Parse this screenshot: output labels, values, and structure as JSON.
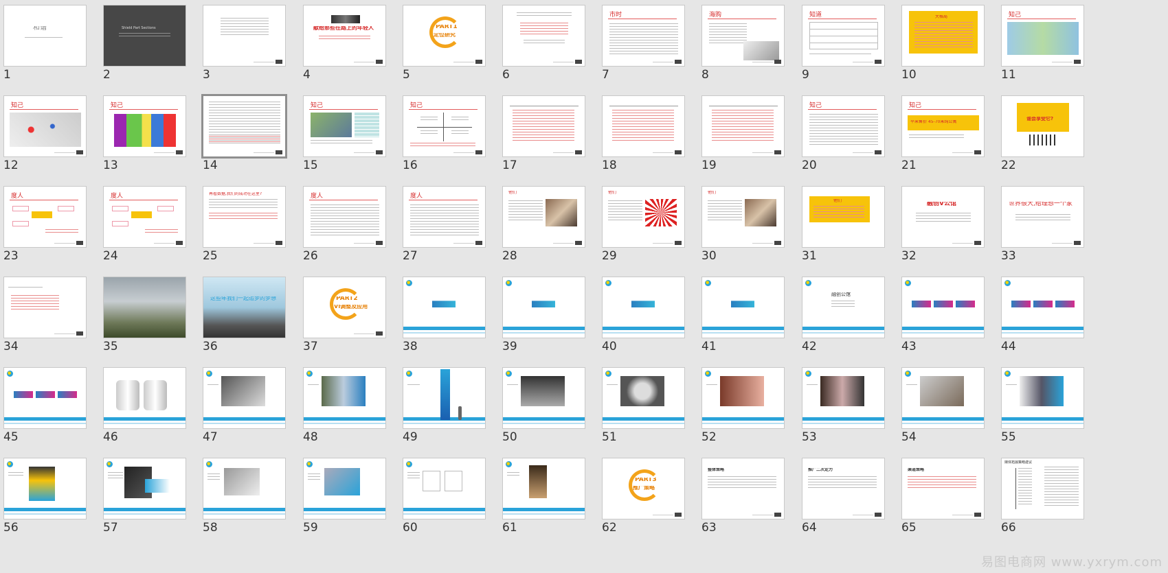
{
  "window": {
    "title": ""
  },
  "slides": [
    {
      "n": "1",
      "kind": "title-white",
      "text": "和谐"
    },
    {
      "n": "2",
      "kind": "title-dark",
      "text": "Shield Part Sections"
    },
    {
      "n": "3",
      "kind": "text-center"
    },
    {
      "n": "4",
      "kind": "banner",
      "text": "献给那些在路上的年轻人"
    },
    {
      "n": "5",
      "kind": "part",
      "text": "PART1",
      "sub": "定位研究"
    },
    {
      "n": "6",
      "kind": "text-center-red"
    },
    {
      "n": "7",
      "kind": "title-text",
      "title": "市时"
    },
    {
      "n": "8",
      "kind": "title-photo",
      "title": "海购"
    },
    {
      "n": "9",
      "kind": "table",
      "title": "知道"
    },
    {
      "n": "10",
      "kind": "yellow-block",
      "text": "大格局"
    },
    {
      "n": "11",
      "kind": "map",
      "title": "知己"
    },
    {
      "n": "12",
      "kind": "map2",
      "title": "知己"
    },
    {
      "n": "13",
      "kind": "colormap",
      "title": "知己"
    },
    {
      "n": "14",
      "kind": "text",
      "selected": true
    },
    {
      "n": "15",
      "kind": "photo-table",
      "title": "知己"
    },
    {
      "n": "16",
      "kind": "cross",
      "title": "知己"
    },
    {
      "n": "17",
      "kind": "timeline"
    },
    {
      "n": "18",
      "kind": "timeline"
    },
    {
      "n": "19",
      "kind": "timeline"
    },
    {
      "n": "20",
      "kind": "title-text",
      "title": "知己"
    },
    {
      "n": "21",
      "kind": "yellow-strip",
      "title": "知己",
      "text": "平米售价 45-70米纯公寓"
    },
    {
      "n": "22",
      "kind": "yellow-people",
      "text": "谁会享受它?"
    },
    {
      "n": "23",
      "kind": "flow",
      "title": "度人"
    },
    {
      "n": "24",
      "kind": "flow2",
      "title": "度人"
    },
    {
      "n": "25",
      "kind": "text-red",
      "title": "再看数据,我们的成功在这里?"
    },
    {
      "n": "26",
      "kind": "title-text",
      "title": "度人"
    },
    {
      "n": "27",
      "kind": "title-text",
      "title": "度人"
    },
    {
      "n": "28",
      "kind": "photo-right",
      "title": "他们"
    },
    {
      "n": "29",
      "kind": "photo-right2",
      "title": "他们"
    },
    {
      "n": "30",
      "kind": "photo-right3",
      "title": "他们"
    },
    {
      "n": "31",
      "kind": "yellow-center",
      "text": "他们"
    },
    {
      "n": "32",
      "kind": "brand",
      "text": "融创V公馆"
    },
    {
      "n": "33",
      "kind": "slogan",
      "text": "世界很大,给理想一个家"
    },
    {
      "n": "34",
      "kind": "list",
      "text": "世界很大,给理想一个家"
    },
    {
      "n": "35",
      "kind": "photo-full"
    },
    {
      "n": "36",
      "kind": "photo-full2",
      "text": "这些年我们一起追梦的梦想"
    },
    {
      "n": "37",
      "kind": "part",
      "text": "PART2",
      "sub": "VI调整及应用"
    },
    {
      "n": "38",
      "kind": "vi-logo"
    },
    {
      "n": "39",
      "kind": "vi-logo"
    },
    {
      "n": "40",
      "kind": "vi-logo"
    },
    {
      "n": "41",
      "kind": "vi-logo"
    },
    {
      "n": "42",
      "kind": "vi-text",
      "text": "融创公馆"
    },
    {
      "n": "43",
      "kind": "vi-three"
    },
    {
      "n": "44",
      "kind": "vi-three"
    },
    {
      "n": "45",
      "kind": "vi-three"
    },
    {
      "n": "46",
      "kind": "vi-cups"
    },
    {
      "n": "47",
      "kind": "vi-photo"
    },
    {
      "n": "48",
      "kind": "vi-photo2"
    },
    {
      "n": "49",
      "kind": "vi-banner"
    },
    {
      "n": "50",
      "kind": "vi-photo3"
    },
    {
      "n": "51",
      "kind": "vi-photo4"
    },
    {
      "n": "52",
      "kind": "vi-photo5"
    },
    {
      "n": "53",
      "kind": "vi-photo6"
    },
    {
      "n": "54",
      "kind": "vi-photo7"
    },
    {
      "n": "55",
      "kind": "vi-photo8"
    },
    {
      "n": "56",
      "kind": "vi-sign"
    },
    {
      "n": "57",
      "kind": "vi-card"
    },
    {
      "n": "58",
      "kind": "vi-paper"
    },
    {
      "n": "59",
      "kind": "vi-paper2"
    },
    {
      "n": "60",
      "kind": "vi-tshirt"
    },
    {
      "n": "61",
      "kind": "vi-bag"
    },
    {
      "n": "62",
      "kind": "part",
      "text": "PART3",
      "sub": "推广策略"
    },
    {
      "n": "63",
      "kind": "text-left",
      "title": "整体策略"
    },
    {
      "n": "64",
      "kind": "text-left2",
      "title": "推广二次定力"
    },
    {
      "n": "65",
      "kind": "text-left3",
      "title": "渠道策略"
    },
    {
      "n": "66",
      "kind": "chart-flow",
      "title": "媒体拓展策略建议"
    }
  ],
  "watermark": "易图电商网 www.yxrym.com",
  "colors": {
    "background": "#e6e6e6",
    "accent_red": "#d62b2b",
    "accent_yellow": "#f7c30a",
    "accent_blue": "#2aa3d9",
    "part_orange": "#f3a31a"
  }
}
